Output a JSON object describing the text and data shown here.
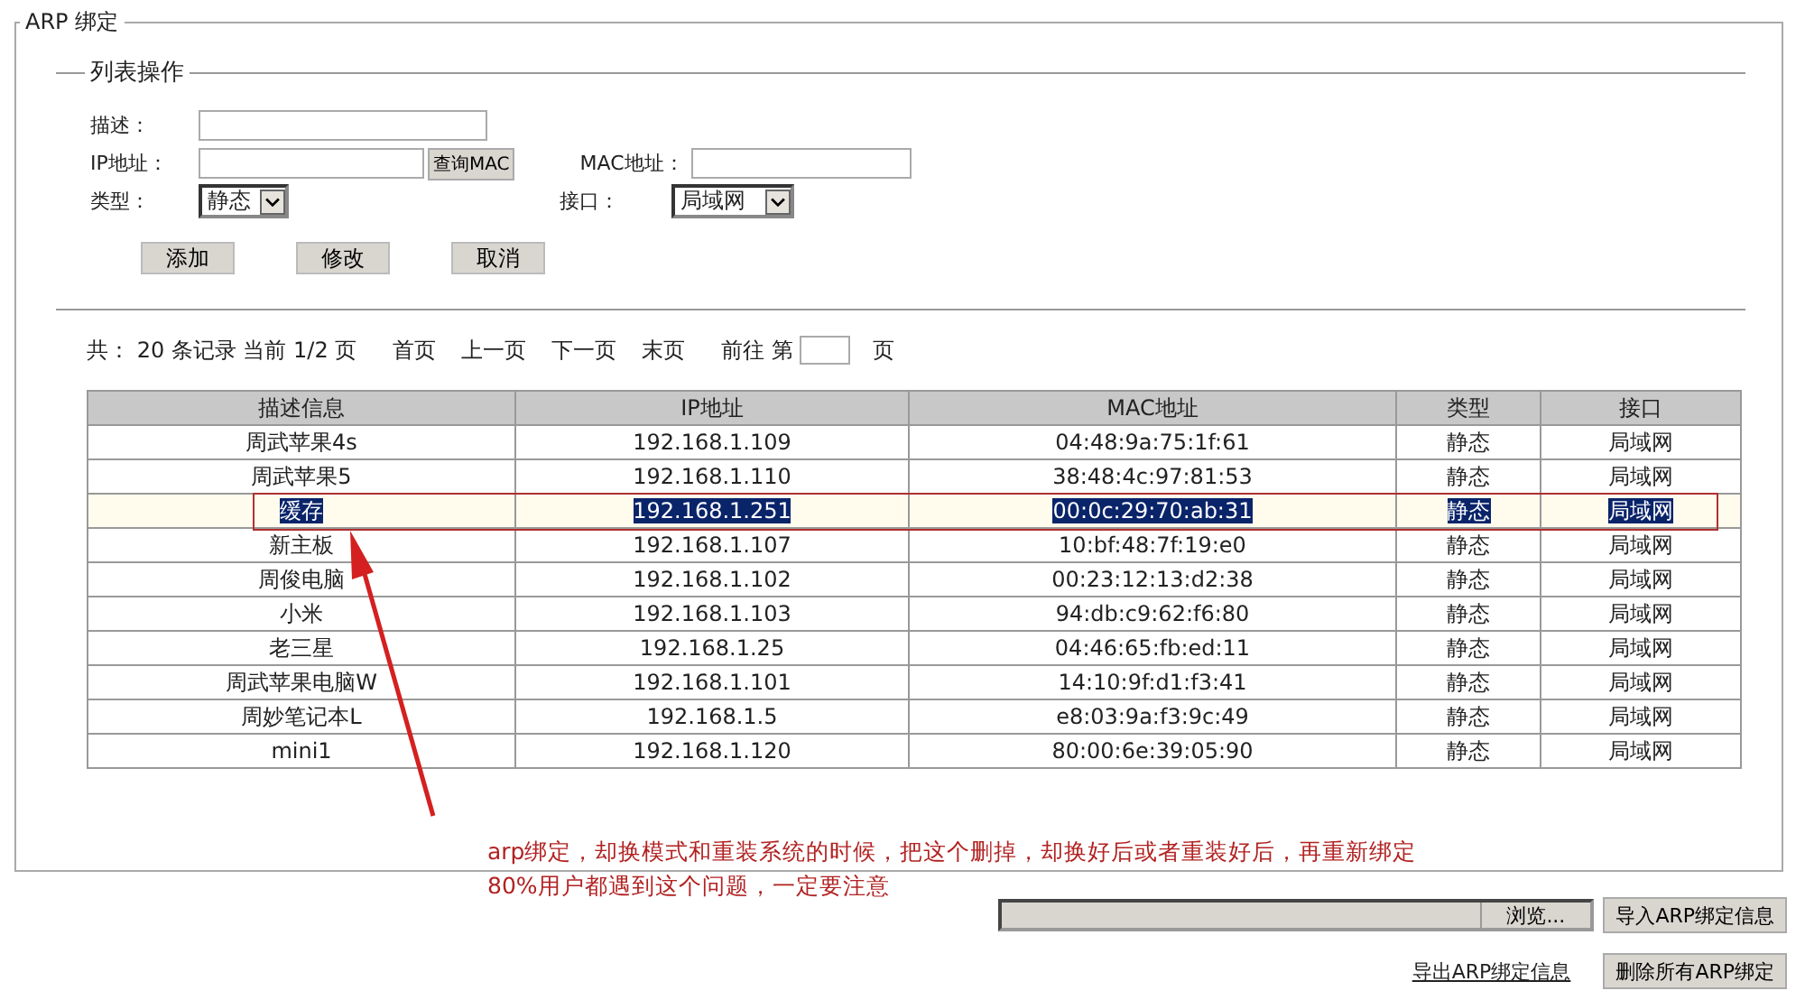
{
  "section_title": "ARP 绑定",
  "form": {
    "title": "列表操作",
    "description": {
      "label": "描述："
    },
    "ip": {
      "label": "IP地址：",
      "button": "查询MAC"
    },
    "mac": {
      "label": "MAC地址："
    },
    "type": {
      "label": "类型：",
      "value": "静态"
    },
    "interface": {
      "label": "接口：",
      "value": "局域网"
    },
    "buttons": [
      "添加",
      "修改",
      "取消"
    ]
  },
  "pagination": {
    "summary": "共： 20 条记录 当前 1/2 页",
    "links": [
      "首页",
      "上一页",
      "下一页",
      "末页"
    ],
    "goto_label": "前往 第",
    "goto_suffix": "页"
  },
  "table": {
    "columns": [
      "描述信息",
      "IP地址",
      "MAC地址",
      "类型",
      "接口"
    ],
    "rows": [
      {
        "cells": [
          "周武苹果4s",
          "192.168.1.109",
          "04:48:9a:75:1f:61",
          "静态",
          "局域网"
        ],
        "selected": false
      },
      {
        "cells": [
          "周武苹果5",
          "192.168.1.110",
          "38:48:4c:97:81:53",
          "静态",
          "局域网"
        ],
        "selected": false
      },
      {
        "cells": [
          "缓存",
          "192.168.1.251",
          "00:0c:29:70:ab:31",
          "静态",
          "局域网"
        ],
        "selected": true
      },
      {
        "cells": [
          "新主板",
          "192.168.1.107",
          "10:bf:48:7f:19:e0",
          "静态",
          "局域网"
        ],
        "selected": false
      },
      {
        "cells": [
          "周俊电脑",
          "192.168.1.102",
          "00:23:12:13:d2:38",
          "静态",
          "局域网"
        ],
        "selected": false
      },
      {
        "cells": [
          "小米",
          "192.168.1.103",
          "94:db:c9:62:f6:80",
          "静态",
          "局域网"
        ],
        "selected": false
      },
      {
        "cells": [
          "老三星",
          "192.168.1.25",
          "04:46:65:fb:ed:11",
          "静态",
          "局域网"
        ],
        "selected": false
      },
      {
        "cells": [
          "周武苹果电脑W",
          "192.168.1.101",
          "14:10:9f:d1:f3:41",
          "静态",
          "局域网"
        ],
        "selected": false
      },
      {
        "cells": [
          "周妙笔记本L",
          "192.168.1.5",
          "e8:03:9a:f3:9c:49",
          "静态",
          "局域网"
        ],
        "selected": false
      },
      {
        "cells": [
          "mini1",
          "192.168.1.120",
          "80:00:6e:39:05:90",
          "静态",
          "局域网"
        ],
        "selected": false
      }
    ]
  },
  "annotation": {
    "lines": [
      "arp绑定，却换模式和重装系统的时候，把这个删掉，却换好后或者重装好后，再重新绑定",
      "80%用户都遇到这个问题，一定要注意"
    ]
  },
  "import": {
    "browse_button": "浏览...",
    "import_button": "导入ARP绑定信息"
  },
  "export_link": "导出ARP绑定信息",
  "delete_all_button": "删除所有ARP绑定"
}
